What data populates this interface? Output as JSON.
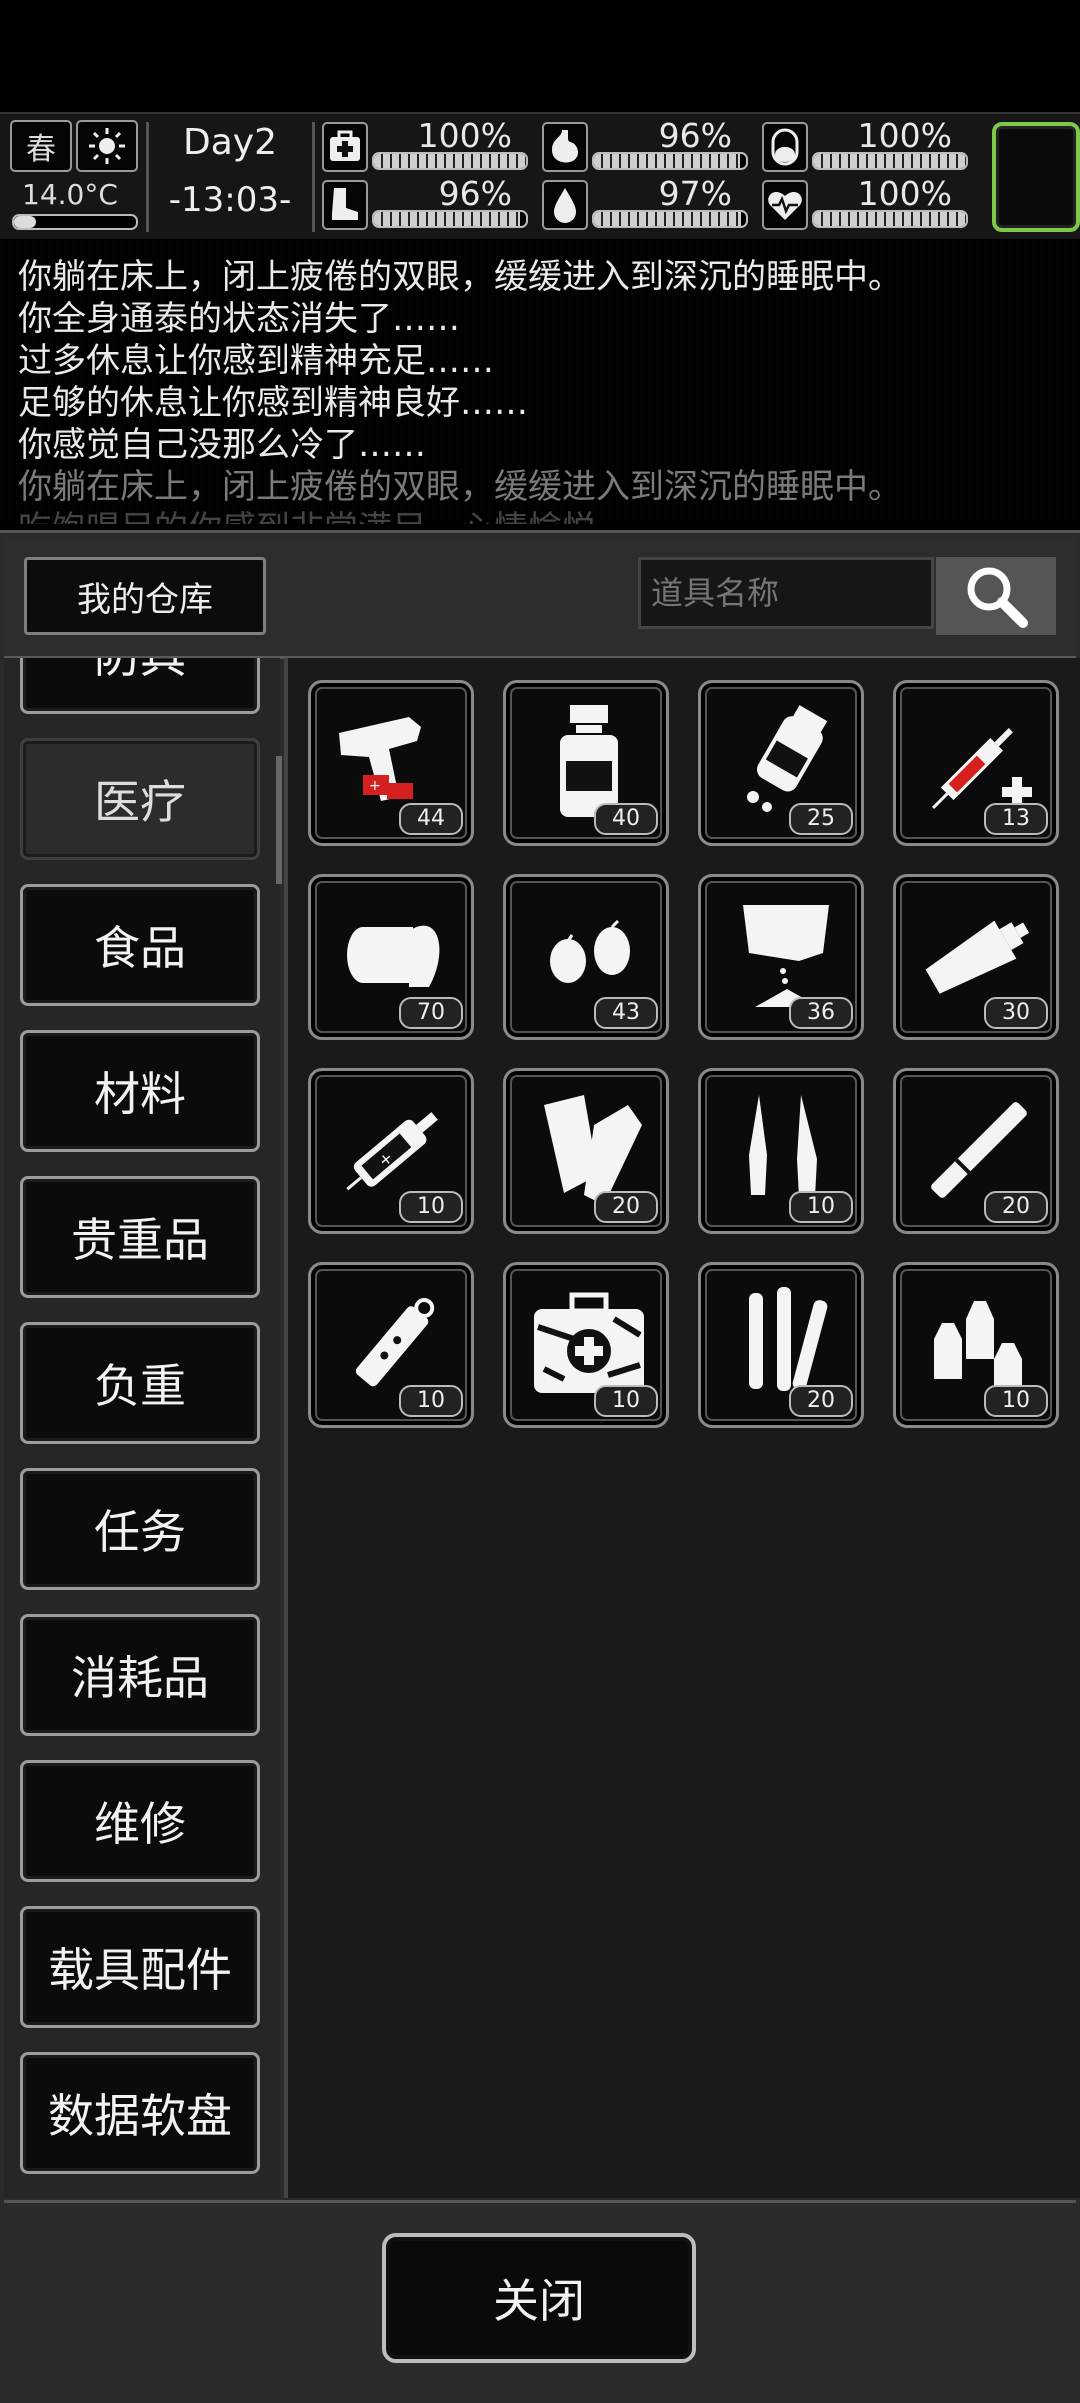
{
  "status": {
    "season": "春",
    "weather_icon": "sun-icon",
    "temperature": "14.0°C",
    "day": "Day2",
    "time": "-13:03-",
    "stats": [
      {
        "icon": "medkit-icon",
        "value": "100%",
        "level": 1.0
      },
      {
        "icon": "stomach-icon",
        "value": "96%",
        "level": 0.96
      },
      {
        "icon": "pill-icon",
        "value": "100%",
        "level": 1.0
      },
      {
        "icon": "boot-icon",
        "value": "96%",
        "level": 0.96
      },
      {
        "icon": "water-drop-icon",
        "value": "97%",
        "level": 0.97
      },
      {
        "icon": "heart-icon",
        "value": "100%",
        "level": 1.0
      }
    ]
  },
  "log": [
    "你躺在床上，闭上疲倦的双眼，缓缓进入到深沉的睡眠中。",
    "你全身通泰的状态消失了……",
    "过多休息让你感到精神充足……",
    "足够的休息让你感到精神良好……",
    "你感觉自己没那么冷了……",
    "你躺在床上，闭上疲倦的双眼，缓缓进入到深沉的睡眠中。",
    "吃饱喝足的你感到非常满足，心情愉悦"
  ],
  "panel": {
    "title": "我的仓库",
    "search_placeholder": "道具名称",
    "categories": [
      "防具",
      "医疗",
      "食品",
      "材料",
      "贵重品",
      "负重",
      "任务",
      "消耗品",
      "维修",
      "载具配件",
      "数据软盘"
    ],
    "active_category": "医疗",
    "items": [
      {
        "icon": "flare-gun-icon",
        "qty": "44"
      },
      {
        "icon": "medicine-bottle-icon",
        "qty": "40"
      },
      {
        "icon": "pill-bottle-icon",
        "qty": "25"
      },
      {
        "icon": "syringe-icon",
        "qty": "13"
      },
      {
        "icon": "bandage-roll-icon",
        "qty": "70"
      },
      {
        "icon": "seeds-icon",
        "qty": "43"
      },
      {
        "icon": "powder-packet-icon",
        "qty": "36"
      },
      {
        "icon": "ointment-tube-icon",
        "qty": "30"
      },
      {
        "icon": "injector-icon",
        "qty": "10"
      },
      {
        "icon": "splint-icon",
        "qty": "20"
      },
      {
        "icon": "ampoule-icon",
        "qty": "10"
      },
      {
        "icon": "stick-icon",
        "qty": "20"
      },
      {
        "icon": "autoinjector-icon",
        "qty": "10"
      },
      {
        "icon": "camo-first-aid-kit-icon",
        "qty": "10"
      },
      {
        "icon": "test-tubes-icon",
        "qty": "20"
      },
      {
        "icon": "drop-bottles-icon",
        "qty": "10"
      }
    ],
    "close_label": "关闭"
  }
}
